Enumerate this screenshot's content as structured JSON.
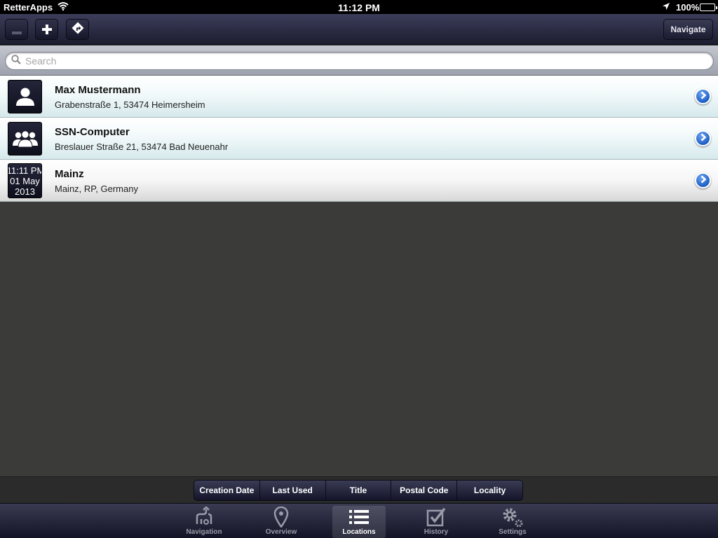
{
  "status_bar": {
    "carrier": "RetterApps",
    "time": "11:12 PM",
    "battery": "100%"
  },
  "toolbar": {
    "navigate_label": "Navigate"
  },
  "search": {
    "placeholder": "Search",
    "value": ""
  },
  "locations": [
    {
      "title": "Max Mustermann",
      "subtitle": "Grabenstraße 1, 53474 Heimersheim",
      "icon": "person-icon"
    },
    {
      "title": "SSN-Computer",
      "subtitle": "Breslauer Straße 21, 53474 Bad Neuenahr",
      "icon": "group-icon"
    },
    {
      "title": "Mainz",
      "subtitle": "Mainz, RP, Germany",
      "icon": "date-badge",
      "date_time": "11:11 PM",
      "date_day": "01 May",
      "date_year": "2013"
    }
  ],
  "sort_options": [
    "Creation Date",
    "Last Used",
    "Title",
    "Postal Code",
    "Locality"
  ],
  "tabs": [
    {
      "label": "Navigation",
      "icon": "navigation-icon"
    },
    {
      "label": "Overview",
      "icon": "map-pin-icon"
    },
    {
      "label": "Locations",
      "icon": "list-icon",
      "active": true
    },
    {
      "label": "History",
      "icon": "checkbox-icon"
    },
    {
      "label": "Settings",
      "icon": "gear-icon"
    }
  ],
  "colors": {
    "accent_blue": "#1d5fc6",
    "toolbar_dark": "#1c1d30",
    "background": "#3b3c3a"
  }
}
